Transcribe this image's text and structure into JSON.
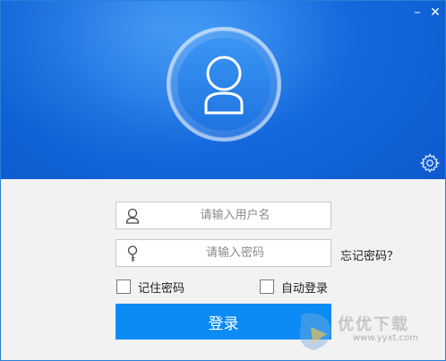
{
  "window": {
    "minimize_label": "–",
    "close_label": "✕"
  },
  "header": {
    "avatar_icon": "user-avatar-icon",
    "settings_icon": "gear-icon",
    "accent_color": "#1468dc"
  },
  "form": {
    "username_placeholder": "请输入用户名",
    "password_placeholder": "请输入密码",
    "forgot_label": "忘记密码？",
    "remember_label": "记住密码",
    "auto_login_label": "自动登录",
    "login_label": "登录",
    "button_color": "#0a8bf5"
  },
  "watermark": {
    "text": "优优下载",
    "url": "www.yyxt.com"
  }
}
